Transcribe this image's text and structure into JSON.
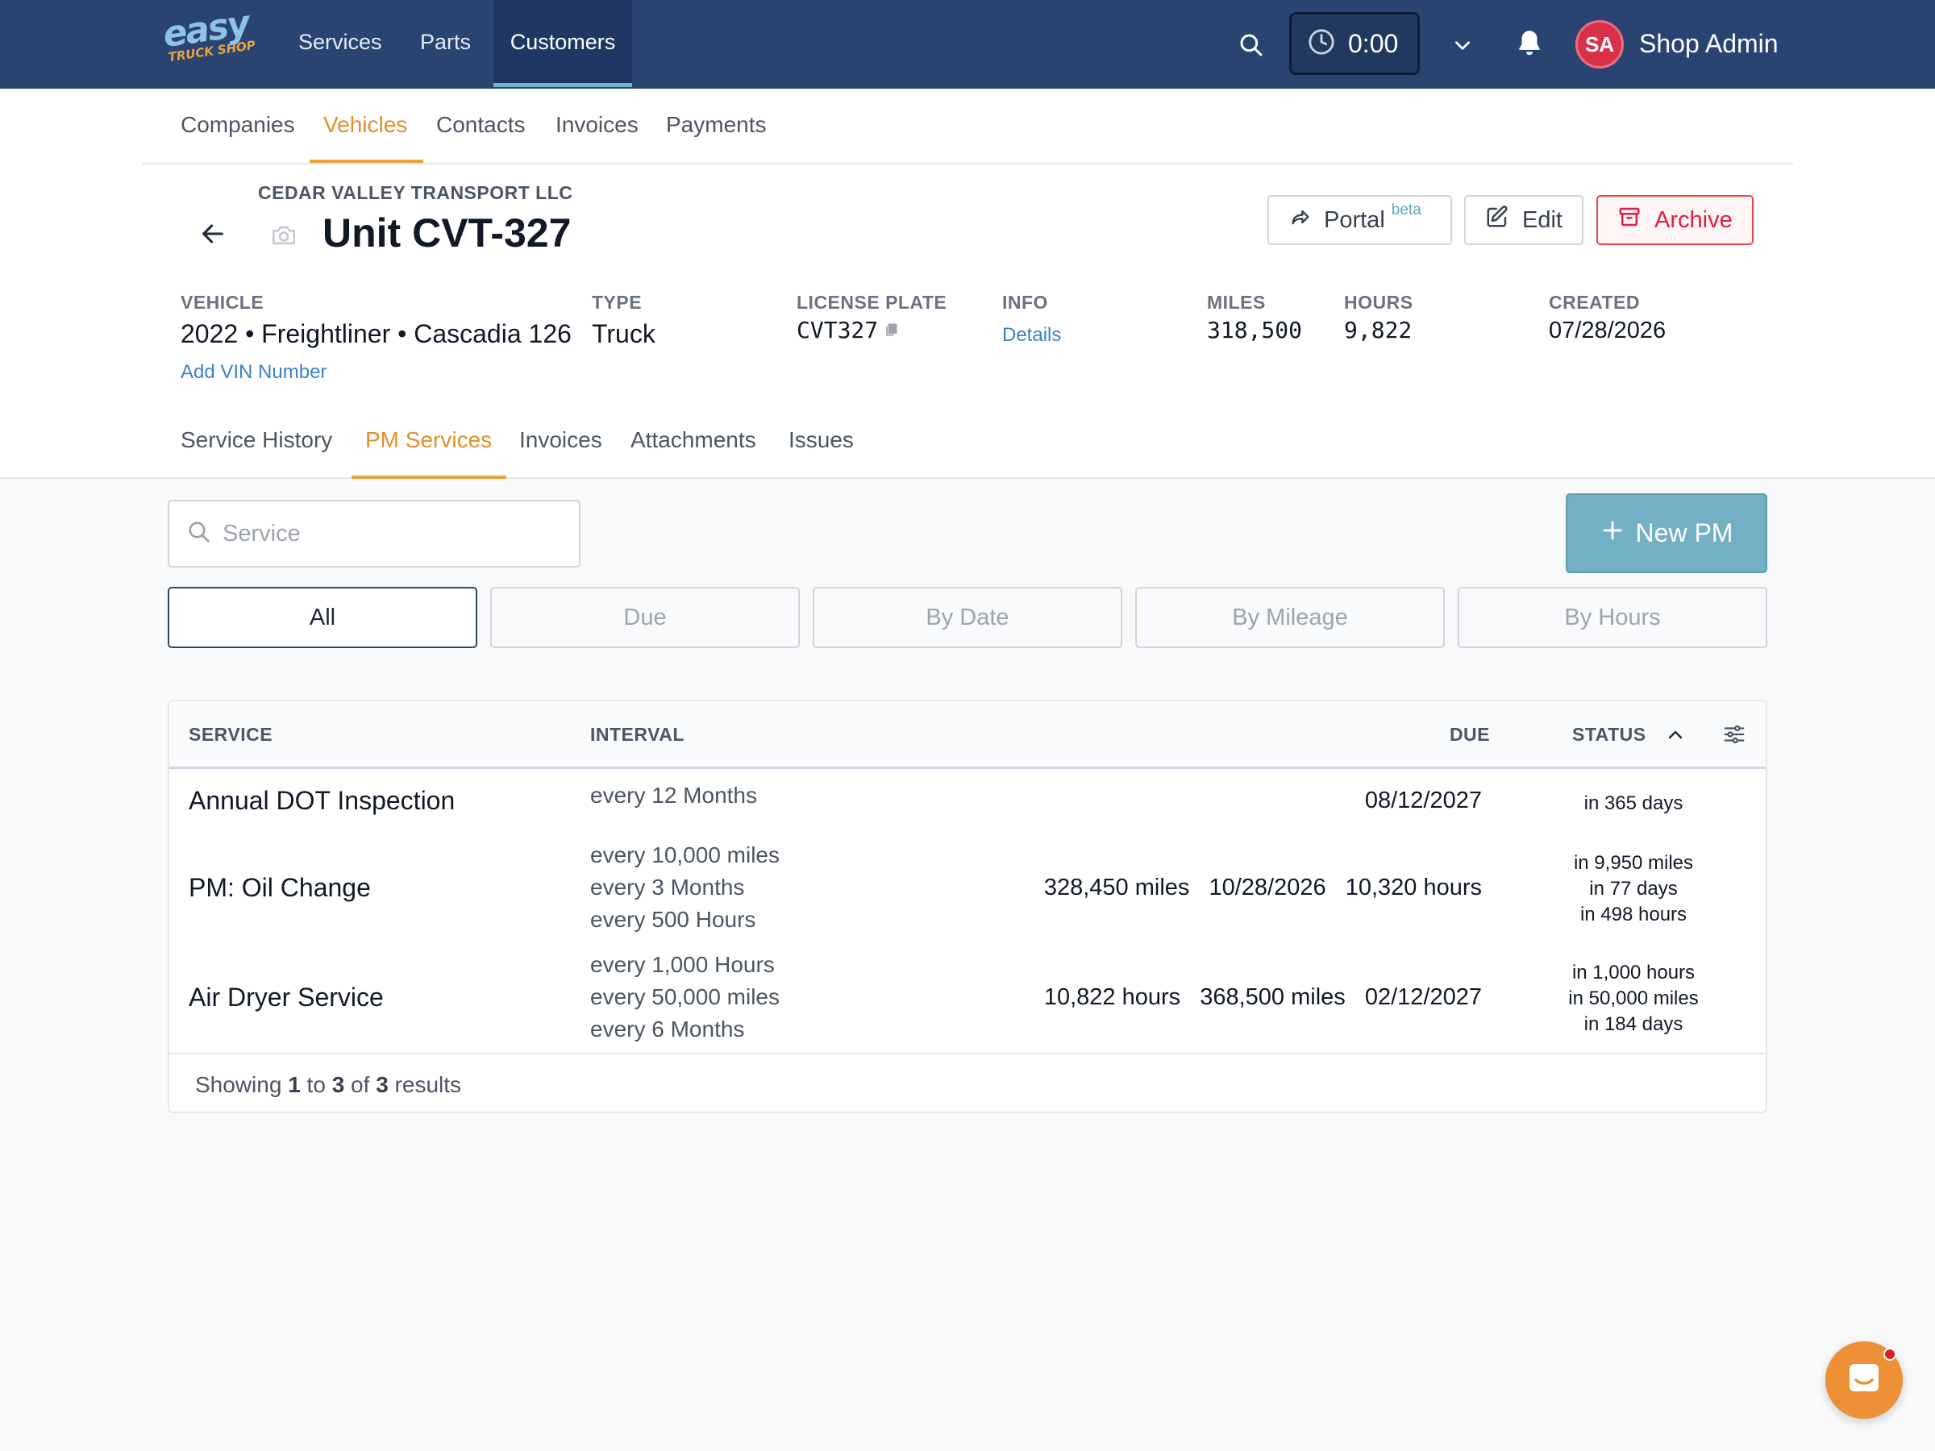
{
  "brand": {
    "logo_main": "easy",
    "logo_sub": "TRUCK SHOP"
  },
  "topnav": {
    "items": [
      "Services",
      "Parts",
      "Customers"
    ],
    "active": "Customers"
  },
  "header": {
    "timer": "0:00",
    "user_initials": "SA",
    "user_name": "Shop Admin"
  },
  "subnav": {
    "items": [
      "Companies",
      "Vehicles",
      "Contacts",
      "Invoices",
      "Payments"
    ],
    "active": "Vehicles"
  },
  "vehicle": {
    "company": "CEDAR VALLEY TRANSPORT LLC",
    "title": "Unit CVT-327",
    "buttons": {
      "portal": "Portal",
      "portal_badge": "beta",
      "edit": "Edit",
      "archive": "Archive"
    },
    "info": {
      "vehicle_label": "VEHICLE",
      "vehicle_value": "2022 • Freightliner • Cascadia 126",
      "add_vin": "Add VIN Number",
      "type_label": "TYPE",
      "type_value": "Truck",
      "plate_label": "LICENSE PLATE",
      "plate_value": "CVT327",
      "info_label": "INFO",
      "info_link": "Details",
      "miles_label": "MILES",
      "miles_value": "318,500",
      "hours_label": "HOURS",
      "hours_value": "9,822",
      "created_label": "CREATED",
      "created_value": "07/28/2026"
    }
  },
  "tabs": {
    "items": [
      "Service History",
      "PM Services",
      "Invoices",
      "Attachments",
      "Issues"
    ],
    "active": "PM Services"
  },
  "toolbar": {
    "search_placeholder": "Service",
    "search_value": "",
    "new_pm": "New PM",
    "filters": [
      "All",
      "Due",
      "By Date",
      "By Mileage",
      "By Hours"
    ],
    "active_filter": "All"
  },
  "table": {
    "headers": {
      "service": "SERVICE",
      "interval": "INTERVAL",
      "due": "DUE",
      "status": "STATUS"
    },
    "rows": [
      {
        "service": "Annual DOT Inspection",
        "interval": [
          "every 12 Months"
        ],
        "due": [
          "08/12/2027"
        ],
        "status": [
          "in 365 days"
        ]
      },
      {
        "service": "PM: Oil Change",
        "interval": [
          "every 10,000 miles",
          "every 3 Months",
          "every 500 Hours"
        ],
        "due": [
          "328,450 miles",
          "10/28/2026",
          "10,320 hours"
        ],
        "status": [
          "in 9,950 miles",
          "in 77 days",
          "in 498 hours"
        ]
      },
      {
        "service": "Air Dryer Service",
        "interval": [
          "every 1,000 Hours",
          "every 50,000 miles",
          "every 6 Months"
        ],
        "due": [
          "10,822 hours",
          "368,500 miles",
          "02/12/2027"
        ],
        "status": [
          "in 1,000 hours",
          "in 50,000 miles",
          "in 184 days"
        ]
      }
    ],
    "footer": {
      "prefix": "Showing",
      "from": "1",
      "to_word": "to",
      "to": "3",
      "of_word": "of",
      "total": "3",
      "suffix": "results"
    }
  },
  "colors": {
    "topbar": "#2a4471",
    "accent_orange": "#e8a33d",
    "primary_button": "#74b0c4",
    "danger": "#ef4444"
  }
}
